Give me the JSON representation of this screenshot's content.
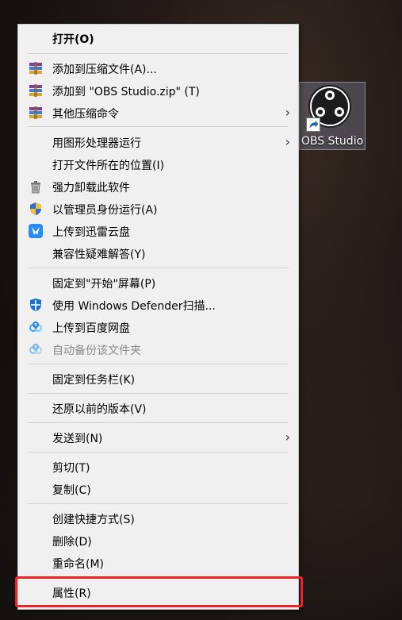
{
  "desktop": {
    "shortcut_label": "OBS Studio",
    "shortcut_icon": "obs-studio-icon"
  },
  "menu": {
    "items": [
      {
        "label": "打开(O)",
        "icon": "",
        "bold": true
      },
      {
        "label": "添加到压缩文件(A)...",
        "icon": "winrar-icon"
      },
      {
        "label": "添加到 \"OBS Studio.zip\" (T)",
        "icon": "winrar-icon"
      },
      {
        "label": "其他压缩命令",
        "icon": "winrar-icon",
        "submenu": true
      },
      {
        "label": "用图形处理器运行",
        "icon": "",
        "submenu": true
      },
      {
        "label": "打开文件所在的位置(I)",
        "icon": ""
      },
      {
        "label": "强力卸载此软件",
        "icon": "trash-icon"
      },
      {
        "label": "以管理员身份运行(A)",
        "icon": "uac-shield-icon"
      },
      {
        "label": "上传到迅雷云盘",
        "icon": "thunder-cloud-icon"
      },
      {
        "label": "兼容性疑难解答(Y)",
        "icon": ""
      },
      {
        "label": "固定到\"开始\"屏幕(P)",
        "icon": ""
      },
      {
        "label": "使用 Windows Defender扫描...",
        "icon": "defender-shield-icon"
      },
      {
        "label": "上传到百度网盘",
        "icon": "baidu-cloud-icon"
      },
      {
        "label": "自动备份该文件夹",
        "icon": "baidu-cloud-icon",
        "disabled": true
      },
      {
        "label": "固定到任务栏(K)",
        "icon": ""
      },
      {
        "label": "还原以前的版本(V)",
        "icon": ""
      },
      {
        "label": "发送到(N)",
        "icon": "",
        "submenu": true
      },
      {
        "label": "剪切(T)",
        "icon": ""
      },
      {
        "label": "复制(C)",
        "icon": ""
      },
      {
        "label": "创建快捷方式(S)",
        "icon": ""
      },
      {
        "label": "删除(D)",
        "icon": ""
      },
      {
        "label": "重命名(M)",
        "icon": ""
      },
      {
        "label": "属性(R)",
        "icon": "",
        "highlighted": true
      }
    ],
    "submenu_arrow": "›",
    "highlight_color": "#e8232a"
  }
}
